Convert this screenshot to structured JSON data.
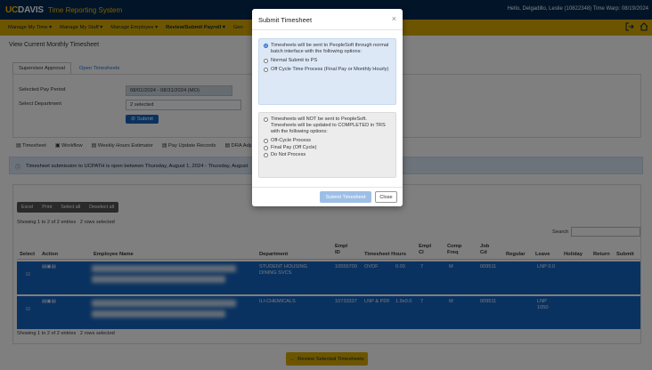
{
  "header": {
    "brand_uc": "UC",
    "brand_name": "DAVIS",
    "app_title": "Time Reporting System",
    "user_info": "Hello, Delgadillo, Leslie (10822348) Time Warp: 08/19/2024"
  },
  "menu": {
    "items": [
      {
        "label": "Manage My Time ▾"
      },
      {
        "label": "Manage My Staff ▾"
      },
      {
        "label": "Manage Employee ▾"
      },
      {
        "label": "Review/Submit Payroll ▾"
      },
      {
        "label": "Gen"
      }
    ],
    "icons": [
      "sign-out-icon",
      "home-icon"
    ]
  },
  "page": {
    "title": "View Current Monthly Timesheet",
    "tabs": [
      {
        "label": "Supervisor Approval"
      },
      {
        "label": "Open Timesheets"
      }
    ],
    "filters": {
      "pay_period_label": "Selected Pay Period",
      "pay_period_value": "08/01/2024 - 08/31/2024 (MO)",
      "department_label": "Select Department",
      "department_value": "2 selected",
      "submit_label": "Submit"
    },
    "links": [
      {
        "label": "Timesheet"
      },
      {
        "label": "Workflow"
      },
      {
        "label": "Weekly Hours Estimator"
      },
      {
        "label": "Pay Update Records"
      },
      {
        "label": "DRA Adjustment"
      }
    ],
    "info_message": "Timesheet submission to UCPATH is open between Thursday, August 1, 2024 - Thursday, August"
  },
  "table": {
    "buttons": [
      "Excel",
      "Print",
      "Select all",
      "Deselect all"
    ],
    "showing_top": "Showing 1 to 2 of 2 entries",
    "selected_top": "2 rows selected",
    "search_label": "Search",
    "columns": [
      "Select",
      "Action",
      "Employee Name",
      "Department",
      "Empl ID",
      "Timesheet Hours",
      "Empl Cl",
      "Comp Freq",
      "Job Cd",
      "Regular",
      "Leave",
      "Holiday",
      "Return",
      "Submit"
    ],
    "rows": [
      {
        "department": "STUDENT HOUSING DINING SVCS",
        "empl_id": "10555700",
        "timesheet_hours": "OVDF",
        "hours": "0.00",
        "empl_cl": "7",
        "comp_freq": "M",
        "job_cd": "009511",
        "leave": "LNP 0.0"
      },
      {
        "department": "ILI-CHEMICALS",
        "empl_id": "10733337",
        "timesheet_hours": "LNP & PDF",
        "hours": "1.9x0.0",
        "empl_cl": "7",
        "comp_freq": "M",
        "job_cd": "009511",
        "leave": "LNP 1050"
      }
    ],
    "showing_bottom": "Showing 1 to 2 of 2 entries",
    "selected_bottom": "2 rows selected"
  },
  "review_button": {
    "label": "Review Selected Timesheets"
  },
  "modal": {
    "title": "Submit Timesheet",
    "close_glyph": "×",
    "blue_box": {
      "heading": "Timesheets will be sent to PeopleSoft through normal batch interface with the following options:",
      "options": [
        "Normal Submit to PS",
        "Off Cycle Time Process (Final Pay or Monthly Hourly)"
      ]
    },
    "gray_box": {
      "heading": "Timesheets will NOT be sent to PeopleSoft. Timesheets will be updated to COMPLETED in TRS with the following options:",
      "options": [
        "Off-Cycle Process",
        "Final Pay (Off Cycle)",
        "Do Not Process"
      ]
    },
    "submit_label": "Submit Timesheet",
    "close_label": "Close"
  }
}
